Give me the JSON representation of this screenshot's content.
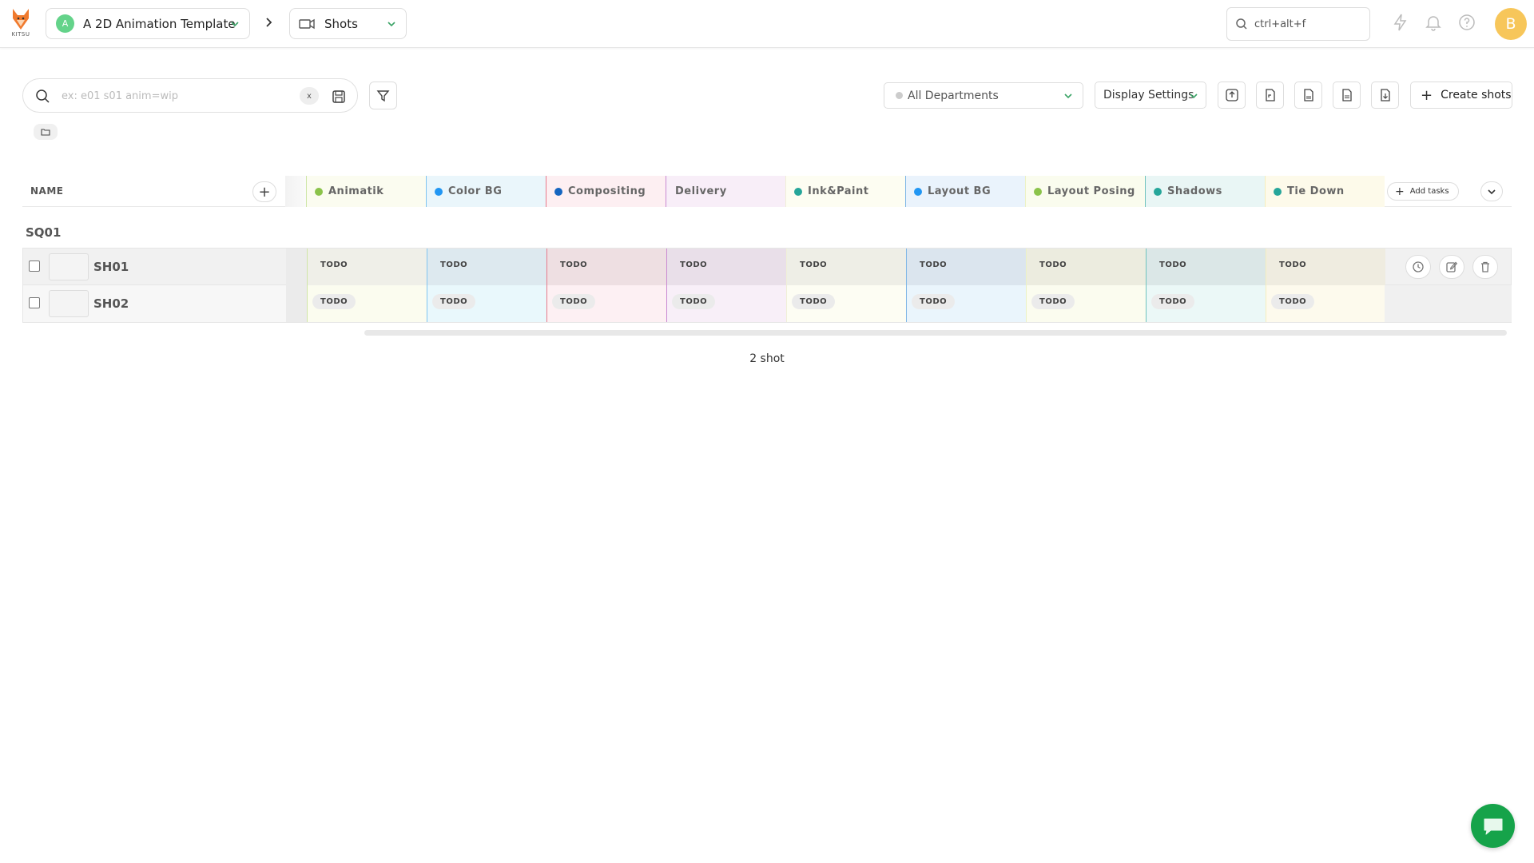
{
  "app": {
    "logo_text": "KITSU"
  },
  "topbar": {
    "project": {
      "avatar_letter": "A",
      "name": "A 2D Animation Template"
    },
    "section": {
      "name": "Shots"
    },
    "search_placeholder": "ctrl+alt+f",
    "user_initial": "B"
  },
  "filters": {
    "search_placeholder": "ex: e01 s01 anim=wip",
    "clear_label": "x",
    "department": "All Departments",
    "display_settings": "Display Settings",
    "create_label": "Create shots"
  },
  "table": {
    "name_header": "NAME",
    "add_tasks_label": "Add tasks",
    "columns": [
      {
        "label": "Animatik",
        "color": "#8bc34a",
        "border": "#cfe6a8",
        "head_bg": "#fbfcf0",
        "cell_r1": "#efefe8",
        "cell_r2": "#fbfcef"
      },
      {
        "label": "Color BG",
        "color": "#2196f3",
        "border": "#7fc4f0",
        "head_bg": "#eaf6fb",
        "cell_r1": "#dde9ef",
        "cell_r2": "#e9f8fc"
      },
      {
        "label": "Compositing",
        "color": "#1565c0",
        "border": "#e87a8a",
        "head_bg": "#fdeff2",
        "cell_r1": "#eedfe2",
        "cell_r2": "#fdf0f3"
      },
      {
        "label": "Delivery",
        "color": "",
        "border": "#c98ad3",
        "head_bg": "#f8eef8",
        "cell_r1": "#e9dfe9",
        "cell_r2": "#f8eff8"
      },
      {
        "label": "Ink&Paint",
        "color": "#26a69a",
        "border": "#f0f0d8",
        "head_bg": "#fdfdf2",
        "cell_r1": "#eeeee6",
        "cell_r2": "#fdfdf3"
      },
      {
        "label": "Layout BG",
        "color": "#2196f3",
        "border": "#7fb6e6",
        "head_bg": "#eaf3fc",
        "cell_r1": "#dbe5ee",
        "cell_r2": "#eaf5fc"
      },
      {
        "label": "Layout Posing",
        "color": "#8bc34a",
        "border": "#ecf2c4",
        "head_bg": "#fafcee",
        "cell_r1": "#ececdf",
        "cell_r2": "#fbfcef"
      },
      {
        "label": "Shadows",
        "color": "#26a69a",
        "border": "#6fc3bd",
        "head_bg": "#e9f6f5",
        "cell_r1": "#dbe7e7",
        "cell_r2": "#ebf8f7"
      },
      {
        "label": "Tie Down",
        "color": "#26a69a",
        "border": "#f6eebd",
        "head_bg": "#fdfaea",
        "cell_r1": "#efece0",
        "cell_r2": "#fdfaed"
      }
    ],
    "sequence": "SQ01",
    "rows": [
      {
        "name": "SH01",
        "statuses": [
          "TODO",
          "TODO",
          "TODO",
          "TODO",
          "TODO",
          "TODO",
          "TODO",
          "TODO",
          "TODO"
        ]
      },
      {
        "name": "SH02",
        "statuses": [
          "TODO",
          "TODO",
          "TODO",
          "TODO",
          "TODO",
          "TODO",
          "TODO",
          "TODO",
          "TODO"
        ]
      }
    ],
    "count_label": "2 shot"
  },
  "icons": {
    "chevron": "chevron-down-icon",
    "search": "search-icon",
    "filter": "filter-icon",
    "chat": "chat-icon"
  }
}
